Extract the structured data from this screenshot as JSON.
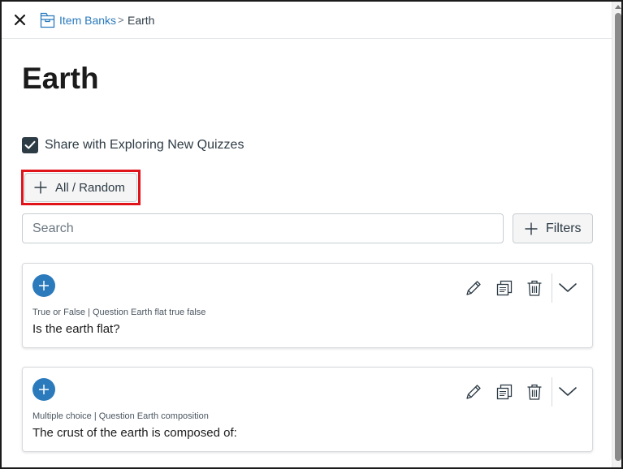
{
  "breadcrumb": {
    "parent": "Item Banks",
    "separator": ">",
    "current": "Earth"
  },
  "page": {
    "title": "Earth"
  },
  "share": {
    "label": "Share with Exploring New Quizzes",
    "checked": true
  },
  "actions": {
    "all_random_label": "All / Random",
    "filters_label": "Filters"
  },
  "search": {
    "placeholder": "Search",
    "value": ""
  },
  "questions": [
    {
      "meta": "True or False | Question Earth flat true false",
      "text": "Is the earth flat?"
    },
    {
      "meta": "Multiple choice | Question Earth composition",
      "text": "The crust of the earth is composed of:"
    }
  ],
  "icons": {
    "close": "close-icon",
    "item_bank": "item-bank-icon",
    "add": "plus-icon",
    "edit": "pencil-icon",
    "copy": "copy-icon",
    "delete": "trash-icon",
    "expand": "chevron-down-icon"
  },
  "colors": {
    "link": "#2b7abc",
    "add_button": "#2b7abc",
    "highlight": "#e0131b",
    "checkbox": "#2d3b45"
  }
}
